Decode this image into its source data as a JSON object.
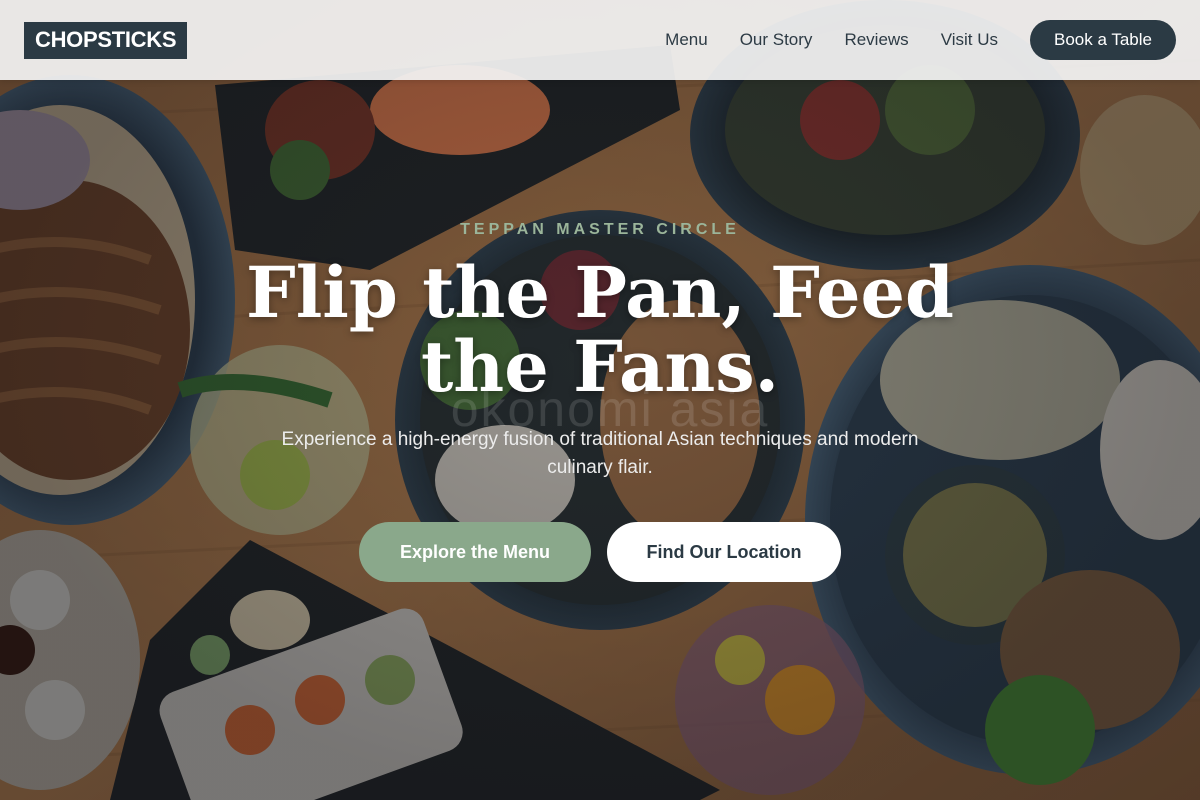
{
  "header": {
    "logo": "CHOPSTICKS",
    "nav": [
      {
        "label": "Menu"
      },
      {
        "label": "Our Story"
      },
      {
        "label": "Reviews"
      },
      {
        "label": "Visit Us"
      }
    ],
    "cta_label": "Book a Table"
  },
  "hero": {
    "eyebrow": "TEPPAN MASTER CIRCLE",
    "headline": "Flip the Pan, Feed the Fans.",
    "subtext": "Experience a high-energy fusion of traditional Asian techniques and modern culinary flair.",
    "watermark": "okonomi asia",
    "primary_button": "Explore the Menu",
    "secondary_button": "Find Our Location",
    "background_image": "asian-food-spread-photo"
  },
  "colors": {
    "brand_dark": "#2b3a44",
    "accent_sage": "#8aa88b",
    "eyebrow_sage": "#9bb59a",
    "table_wood": "#b77f4c"
  }
}
